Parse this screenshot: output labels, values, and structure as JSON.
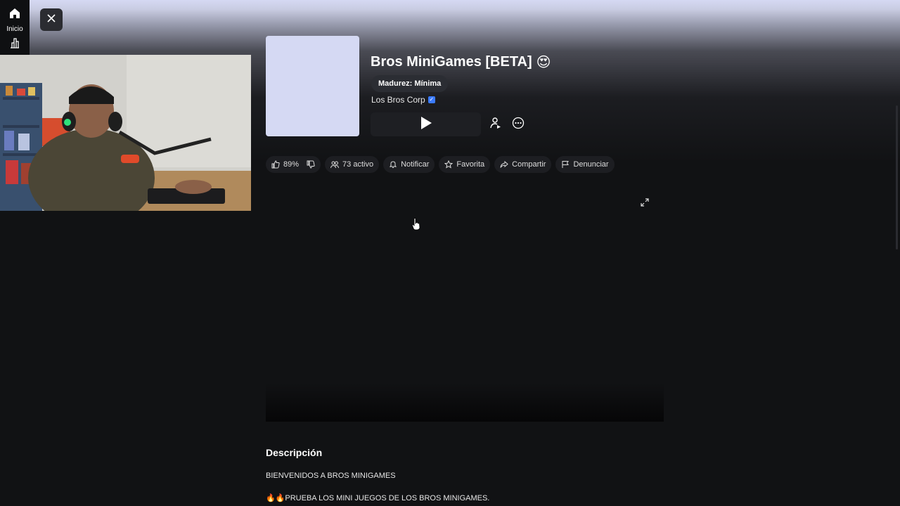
{
  "nav": {
    "home_label": "Inicio",
    "home_icon": "home-icon",
    "charts_icon": "bar-chart-icon"
  },
  "game": {
    "title": "Bros MiniGames [BETA]",
    "title_emoji": "😍",
    "maturity": "Madurez: Mínima",
    "creator": "Los Bros Corp",
    "verified_mark": "✓"
  },
  "actions": {
    "like_percent": "89%",
    "active_count": "73 activo",
    "notify": "Notificar",
    "favorite": "Favorita",
    "share": "Compartir",
    "report": "Denunciar"
  },
  "description": {
    "heading": "Descripción",
    "line1": "BIENVENIDOS A BROS MINIGAMES",
    "line2_emoji": "🔥🔥",
    "line2_text": "PRUEBA LOS MINI JUEGOS DE LOS BROS MINIGAMES."
  },
  "colors": {
    "background": "#111214",
    "thumbnail": "#d5d9f3",
    "pill": "#1d1e22",
    "verified": "#3b7bff"
  }
}
